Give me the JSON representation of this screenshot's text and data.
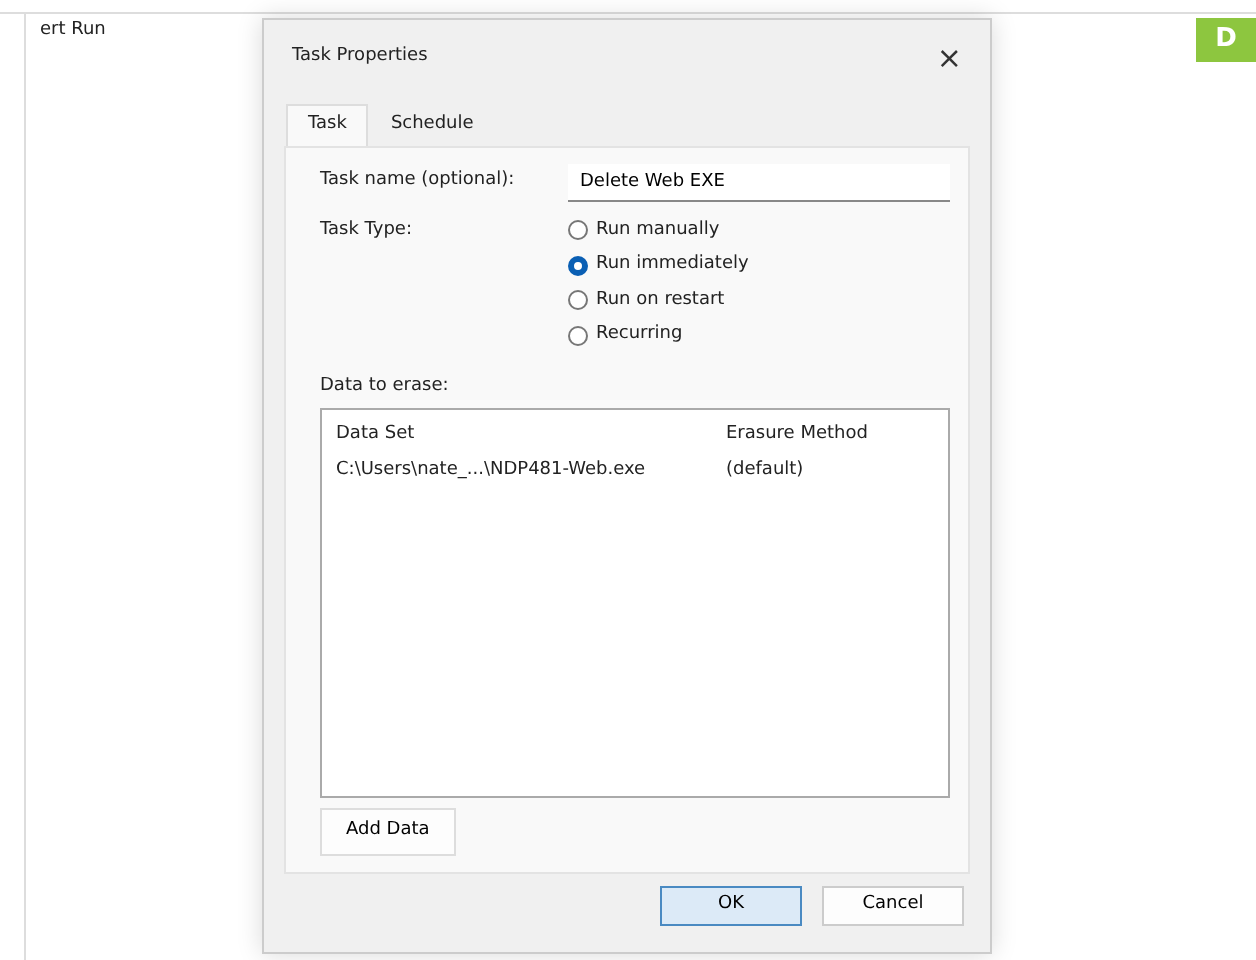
{
  "background_window": {
    "label": "ert Run"
  },
  "badge": {
    "text": "D"
  },
  "dialog": {
    "title": "Task Properties",
    "close": "×",
    "tabs": [
      {
        "label": "Task",
        "selected": true
      },
      {
        "label": "Schedule",
        "selected": false
      }
    ],
    "task_name": {
      "label": "Task name (optional):",
      "value": "Delete Web EXE"
    },
    "task_type": {
      "label": "Task Type:",
      "options": [
        {
          "label": "Run manually",
          "selected": false
        },
        {
          "label": "Run immediately",
          "selected": true
        },
        {
          "label": "Run on restart",
          "selected": false
        },
        {
          "label": "Recurring",
          "selected": false
        }
      ]
    },
    "data_to_erase": {
      "label": "Data to erase:",
      "columns": [
        "Data Set",
        "Erasure Method"
      ],
      "rows": [
        [
          "C:\\Users\\nate_...\\NDP481-Web.exe",
          "(default)"
        ]
      ]
    },
    "add_button": "Add Data",
    "buttons": [
      "OK",
      "Cancel"
    ]
  }
}
